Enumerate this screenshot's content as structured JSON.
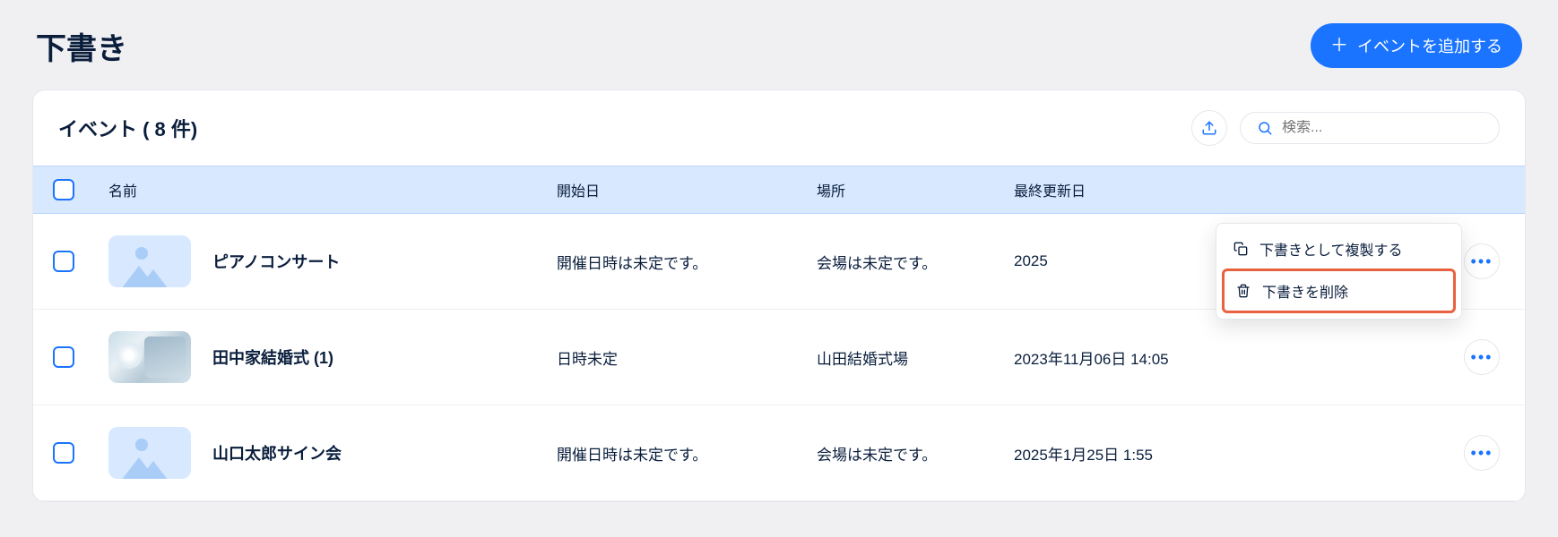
{
  "header": {
    "title": "下書き",
    "add_button": "イベントを追加する"
  },
  "card": {
    "title": "イベント ( 8 件)",
    "search_placeholder": "検索..."
  },
  "columns": {
    "name": "名前",
    "start": "開始日",
    "place": "場所",
    "updated": "最終更新日"
  },
  "rows": [
    {
      "name": "ピアノコンサート",
      "start": "開催日時は未定です。",
      "place": "会場は未定です。",
      "updated": "2025",
      "thumb": "placeholder",
      "menu_open": true
    },
    {
      "name": "田中家結婚式 (1)",
      "start": "日時未定",
      "place": "山田結婚式場",
      "updated": "2023年11月06日 14:05",
      "thumb": "photo",
      "menu_open": false
    },
    {
      "name": "山口太郎サイン会",
      "start": "開催日時は未定です。",
      "place": "会場は未定です。",
      "updated": "2025年1月25日 1:55",
      "thumb": "placeholder",
      "menu_open": false
    }
  ],
  "dropdown": {
    "duplicate": "下書きとして複製する",
    "delete": "下書きを削除"
  }
}
